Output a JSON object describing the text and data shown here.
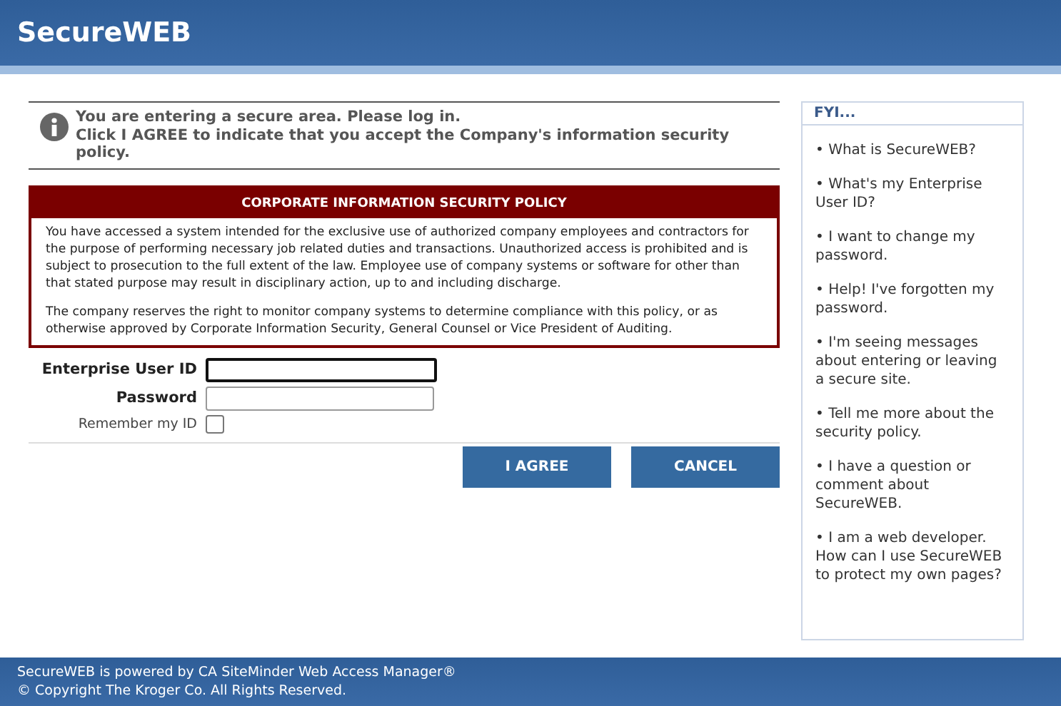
{
  "header": {
    "title": "SecureWEB"
  },
  "notice": {
    "lines": [
      "You are entering a secure area.  Please log in.",
      "Click I AGREE to indicate that you accept the Company's information security policy."
    ]
  },
  "policy": {
    "title": "CORPORATE INFORMATION SECURITY POLICY",
    "paragraphs": [
      "You have accessed a system intended for the exclusive use of authorized company employees and contractors for the purpose of performing necessary job related duties and transactions. Unauthorized access is prohibited and is subject to prosecution to the full extent of the law. Employee use of company systems or software for other than that stated purpose may result in disciplinary action, up to and including discharge.",
      "The company reserves the right to monitor company systems to determine compliance with this policy, or as otherwise approved by Corporate Information Security, General Counsel or Vice President of Auditing."
    ]
  },
  "fields": [
    {
      "label": "Enterprise User ID",
      "focused": true
    },
    {
      "label": "Password",
      "focused": false
    }
  ],
  "remember": {
    "label": "Remember my ID",
    "checked": false
  },
  "buttons": [
    "I AGREE",
    "CANCEL"
  ],
  "fyi": {
    "title": "FYI...",
    "links": [
      "• What is SecureWEB?",
      "• What's my Enterprise User ID?",
      "• I want to change my password.",
      "• Help!  I've forgotten my password.",
      "• I'm seeing messages about entering or leaving a secure site.",
      "• Tell me more about the security policy.",
      "• I have a question or comment about SecureWEB.",
      "• I am a web developer. How can I use SecureWEB to protect my own pages?"
    ]
  },
  "footer": {
    "lines": [
      "SecureWEB is powered by CA SiteMinder Web Access Manager®",
      "© Copyright The Kroger Co. All Rights Reserved."
    ]
  }
}
